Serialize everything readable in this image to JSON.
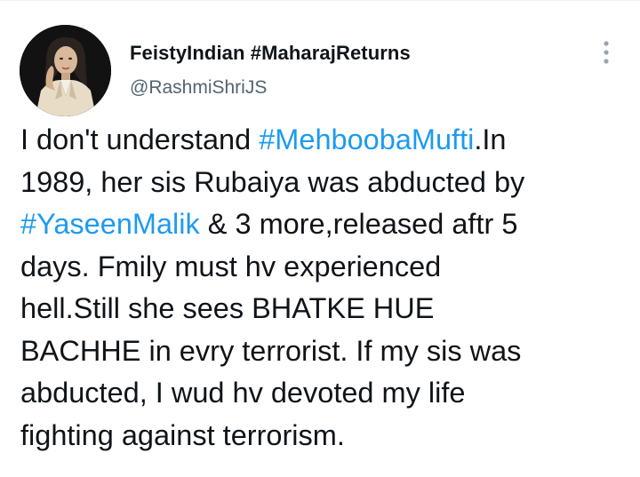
{
  "tweet": {
    "author": {
      "display_name": "FeistyIndian #MaharajReturns",
      "handle": "@RashmiShriJS"
    },
    "more_icon": "vertical-dots-icon",
    "colors": {
      "text": "#0f1419",
      "secondary": "#536471",
      "link": "#1d9bf0"
    },
    "lines": [
      {
        "before": "I don't understand ",
        "hashtag": "#MehboobaMufti",
        "after": ".In"
      },
      {
        "text": "1989, her sis Rubaiya was abducted by"
      },
      {
        "hashtag": "#YaseenMalik",
        "after": " & 3 more,released aftr 5"
      },
      {
        "text": "days. Fmily must hv experienced"
      },
      {
        "text": "hell.Still she sees BHATKE HUE"
      },
      {
        "text": "BACHHE in evry terrorist. If my sis was"
      },
      {
        "text": "abducted, I wud hv devoted my life"
      },
      {
        "text": "fighting against terrorism."
      }
    ]
  }
}
